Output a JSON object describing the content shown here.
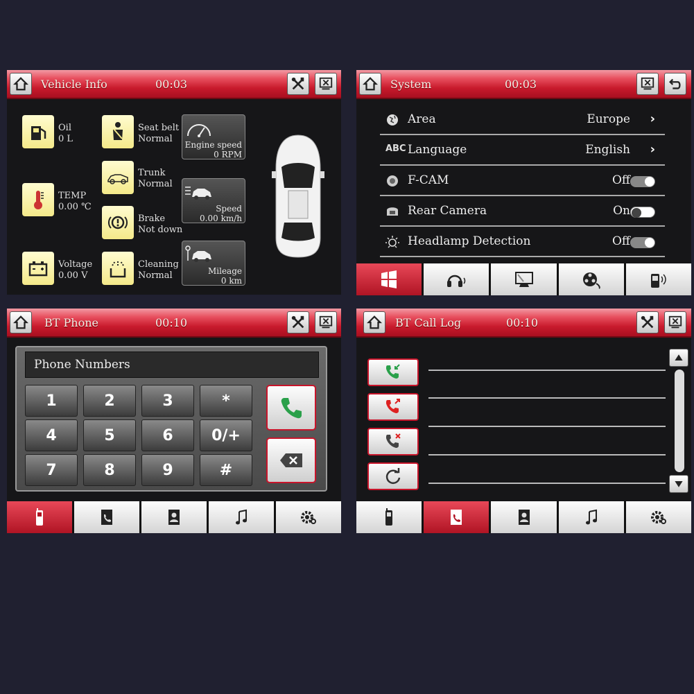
{
  "vehicle": {
    "title": "Vehicle Info",
    "time": "00:03",
    "oil": {
      "label": "Oil",
      "value": "0 L"
    },
    "temp": {
      "label": "TEMP",
      "value": "0.00 ℃"
    },
    "voltage": {
      "label": "Voltage",
      "value": "0.00 V"
    },
    "seatbelt": {
      "label": "Seat belt",
      "value": "Normal"
    },
    "trunk": {
      "label": "Trunk",
      "value": "Normal"
    },
    "brake": {
      "label": "Brake",
      "value": "Not down"
    },
    "cleaning": {
      "label": "Cleaning",
      "value": "Normal"
    },
    "engine": {
      "label": "Engine speed",
      "value": "0 RPM"
    },
    "speed": {
      "label": "Speed",
      "value": "0.00 km/h"
    },
    "mileage": {
      "label": "Mileage",
      "value": "0 km"
    }
  },
  "system": {
    "title": "System",
    "time": "00:03",
    "rows": [
      {
        "icon": "globe-icon",
        "label": "Area",
        "value": "Europe"
      },
      {
        "icon": "abc-icon",
        "icon_text": "ABC",
        "label": "Language",
        "value": "English"
      },
      {
        "icon": "fcam-icon",
        "label": "F-CAM",
        "value": "Off",
        "toggle": false
      },
      {
        "icon": "rear-camera-icon",
        "label": "Rear Camera",
        "value": "On",
        "toggle": true
      },
      {
        "icon": "headlamp-icon",
        "label": "Headlamp Detection",
        "value": "Off",
        "toggle": false
      }
    ],
    "tabs": [
      "windows-icon",
      "headphones-icon",
      "monitor-icon",
      "film-reel-icon",
      "phone-audio-icon"
    ],
    "active_tab": 0
  },
  "bt_phone": {
    "title": "BT Phone",
    "time": "00:10",
    "display_placeholder": "Phone Numbers",
    "keys": [
      "1",
      "2",
      "3",
      "*",
      "4",
      "5",
      "6",
      "0/+",
      "7",
      "8",
      "9",
      "#"
    ],
    "tabs": [
      "mobile-phone-icon",
      "phonebook-icon",
      "contacts-icon",
      "music-note-icon",
      "settings-gear-icon"
    ],
    "active_tab": 0
  },
  "bt_call_log": {
    "title": "BT Call Log",
    "time": "00:10",
    "filters": [
      "received-call-icon",
      "dialed-call-icon",
      "missed-call-icon",
      "refresh-icon"
    ],
    "tabs": [
      "mobile-phone-icon",
      "phonebook-icon",
      "contacts-icon",
      "music-note-icon",
      "settings-gear-icon"
    ],
    "active_tab": 1
  },
  "colors": {
    "header_red": "#c81a2c",
    "panel_bg": "#161618",
    "page_bg": "#202030",
    "icon_yellow": "#f4e98a"
  }
}
